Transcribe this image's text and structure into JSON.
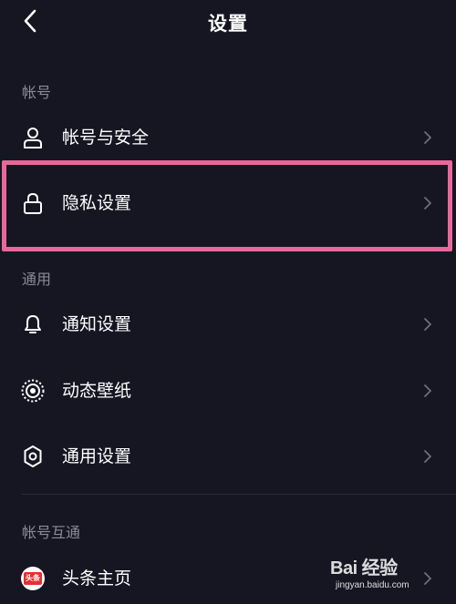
{
  "header": {
    "title": "设置",
    "back_icon": "chevron-left-icon"
  },
  "sections": [
    {
      "label": "帐号",
      "items": [
        {
          "label": "帐号与安全",
          "icon": "user-icon"
        },
        {
          "label": "隐私设置",
          "icon": "lock-icon",
          "highlighted": true
        }
      ]
    },
    {
      "label": "通用",
      "items": [
        {
          "label": "通知设置",
          "icon": "bell-icon"
        },
        {
          "label": "动态壁纸",
          "icon": "live-wallpaper-icon"
        },
        {
          "label": "通用设置",
          "icon": "gear-icon"
        }
      ]
    },
    {
      "label": "帐号互通",
      "items": [
        {
          "label": "头条主页",
          "icon": "toutiao-icon",
          "icon_text": "头条"
        }
      ]
    }
  ],
  "highlight_color": "#e9679a",
  "watermark": {
    "main": "Bai 经验",
    "sub": "jingyan.baidu.com"
  }
}
